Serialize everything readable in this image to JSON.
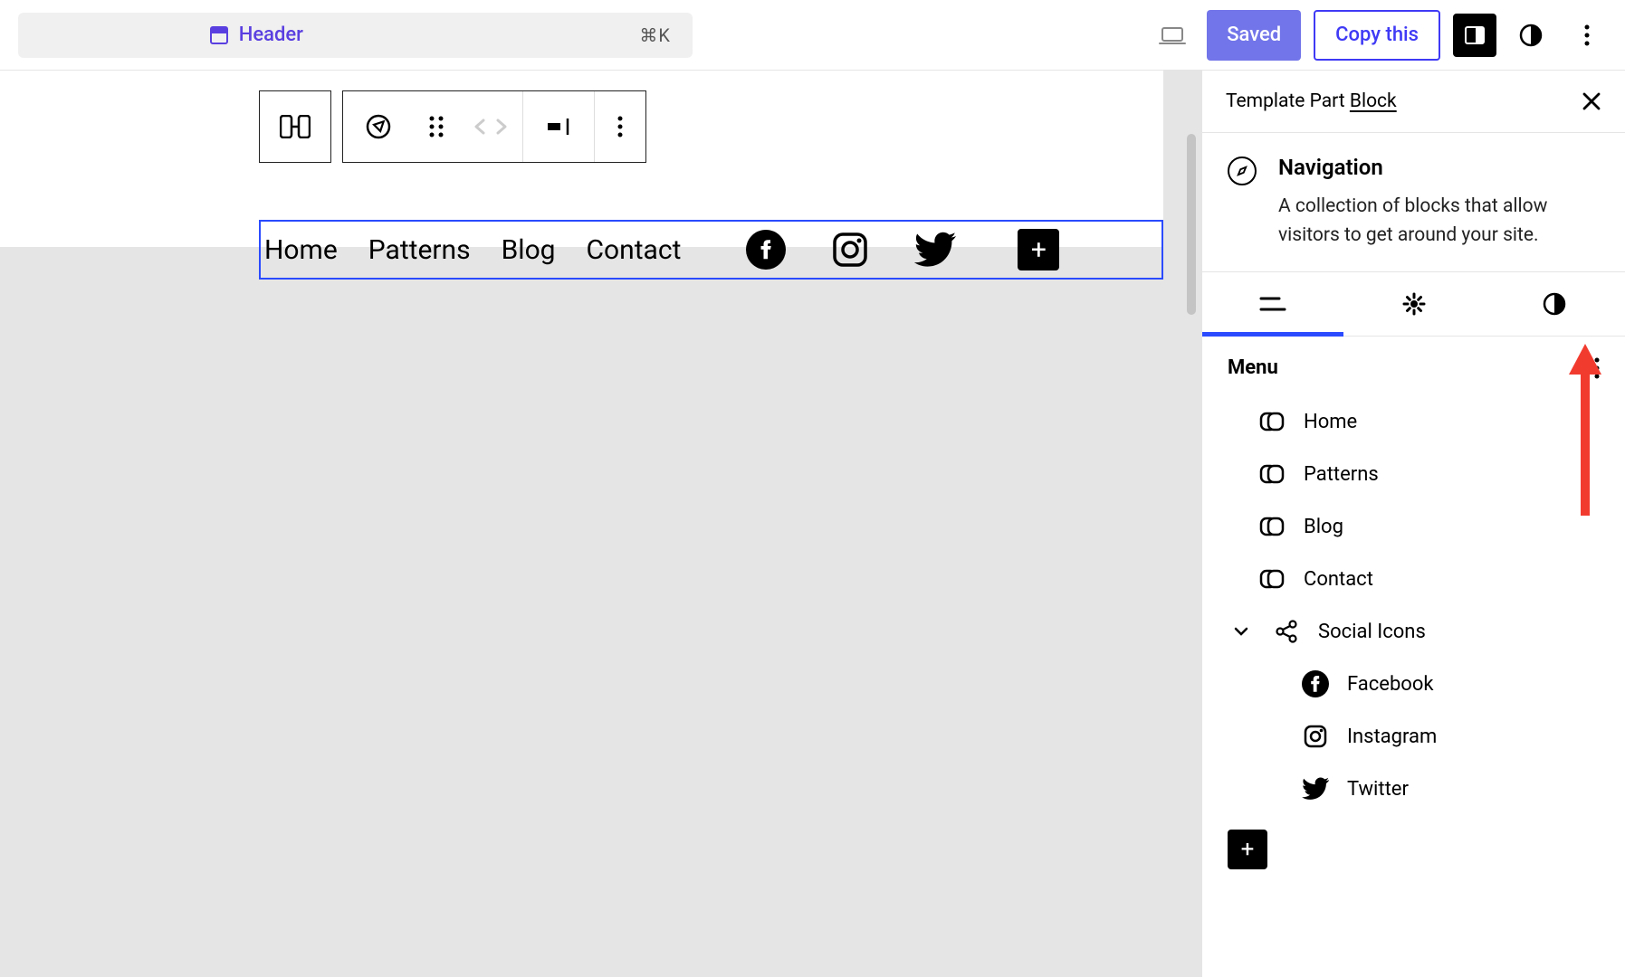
{
  "topbar": {
    "search_label": "Header",
    "search_shortcut": "⌘K",
    "saved_label": "Saved",
    "copy_label": "Copy this"
  },
  "nav": {
    "items": [
      "Home",
      "Patterns",
      "Blog",
      "Contact"
    ],
    "social": [
      "Facebook",
      "Instagram",
      "Twitter"
    ]
  },
  "sidebar": {
    "header_prefix": "Template Part ",
    "header_link": " Block ",
    "block_title": "Navigation",
    "block_desc": "A collection of blocks that allow visitors to get around your site.",
    "menu_title": "Menu",
    "menu_items": [
      {
        "label": "Home",
        "type": "link"
      },
      {
        "label": "Patterns",
        "type": "link"
      },
      {
        "label": "Blog",
        "type": "link"
      },
      {
        "label": "Contact",
        "type": "link"
      },
      {
        "label": "Social Icons",
        "type": "group",
        "children": [
          {
            "label": "Facebook",
            "icon": "facebook"
          },
          {
            "label": "Instagram",
            "icon": "instagram"
          },
          {
            "label": "Twitter",
            "icon": "twitter"
          }
        ]
      }
    ]
  },
  "colors": {
    "accent": "#2b4bff",
    "annotation": "#f23b2f"
  }
}
